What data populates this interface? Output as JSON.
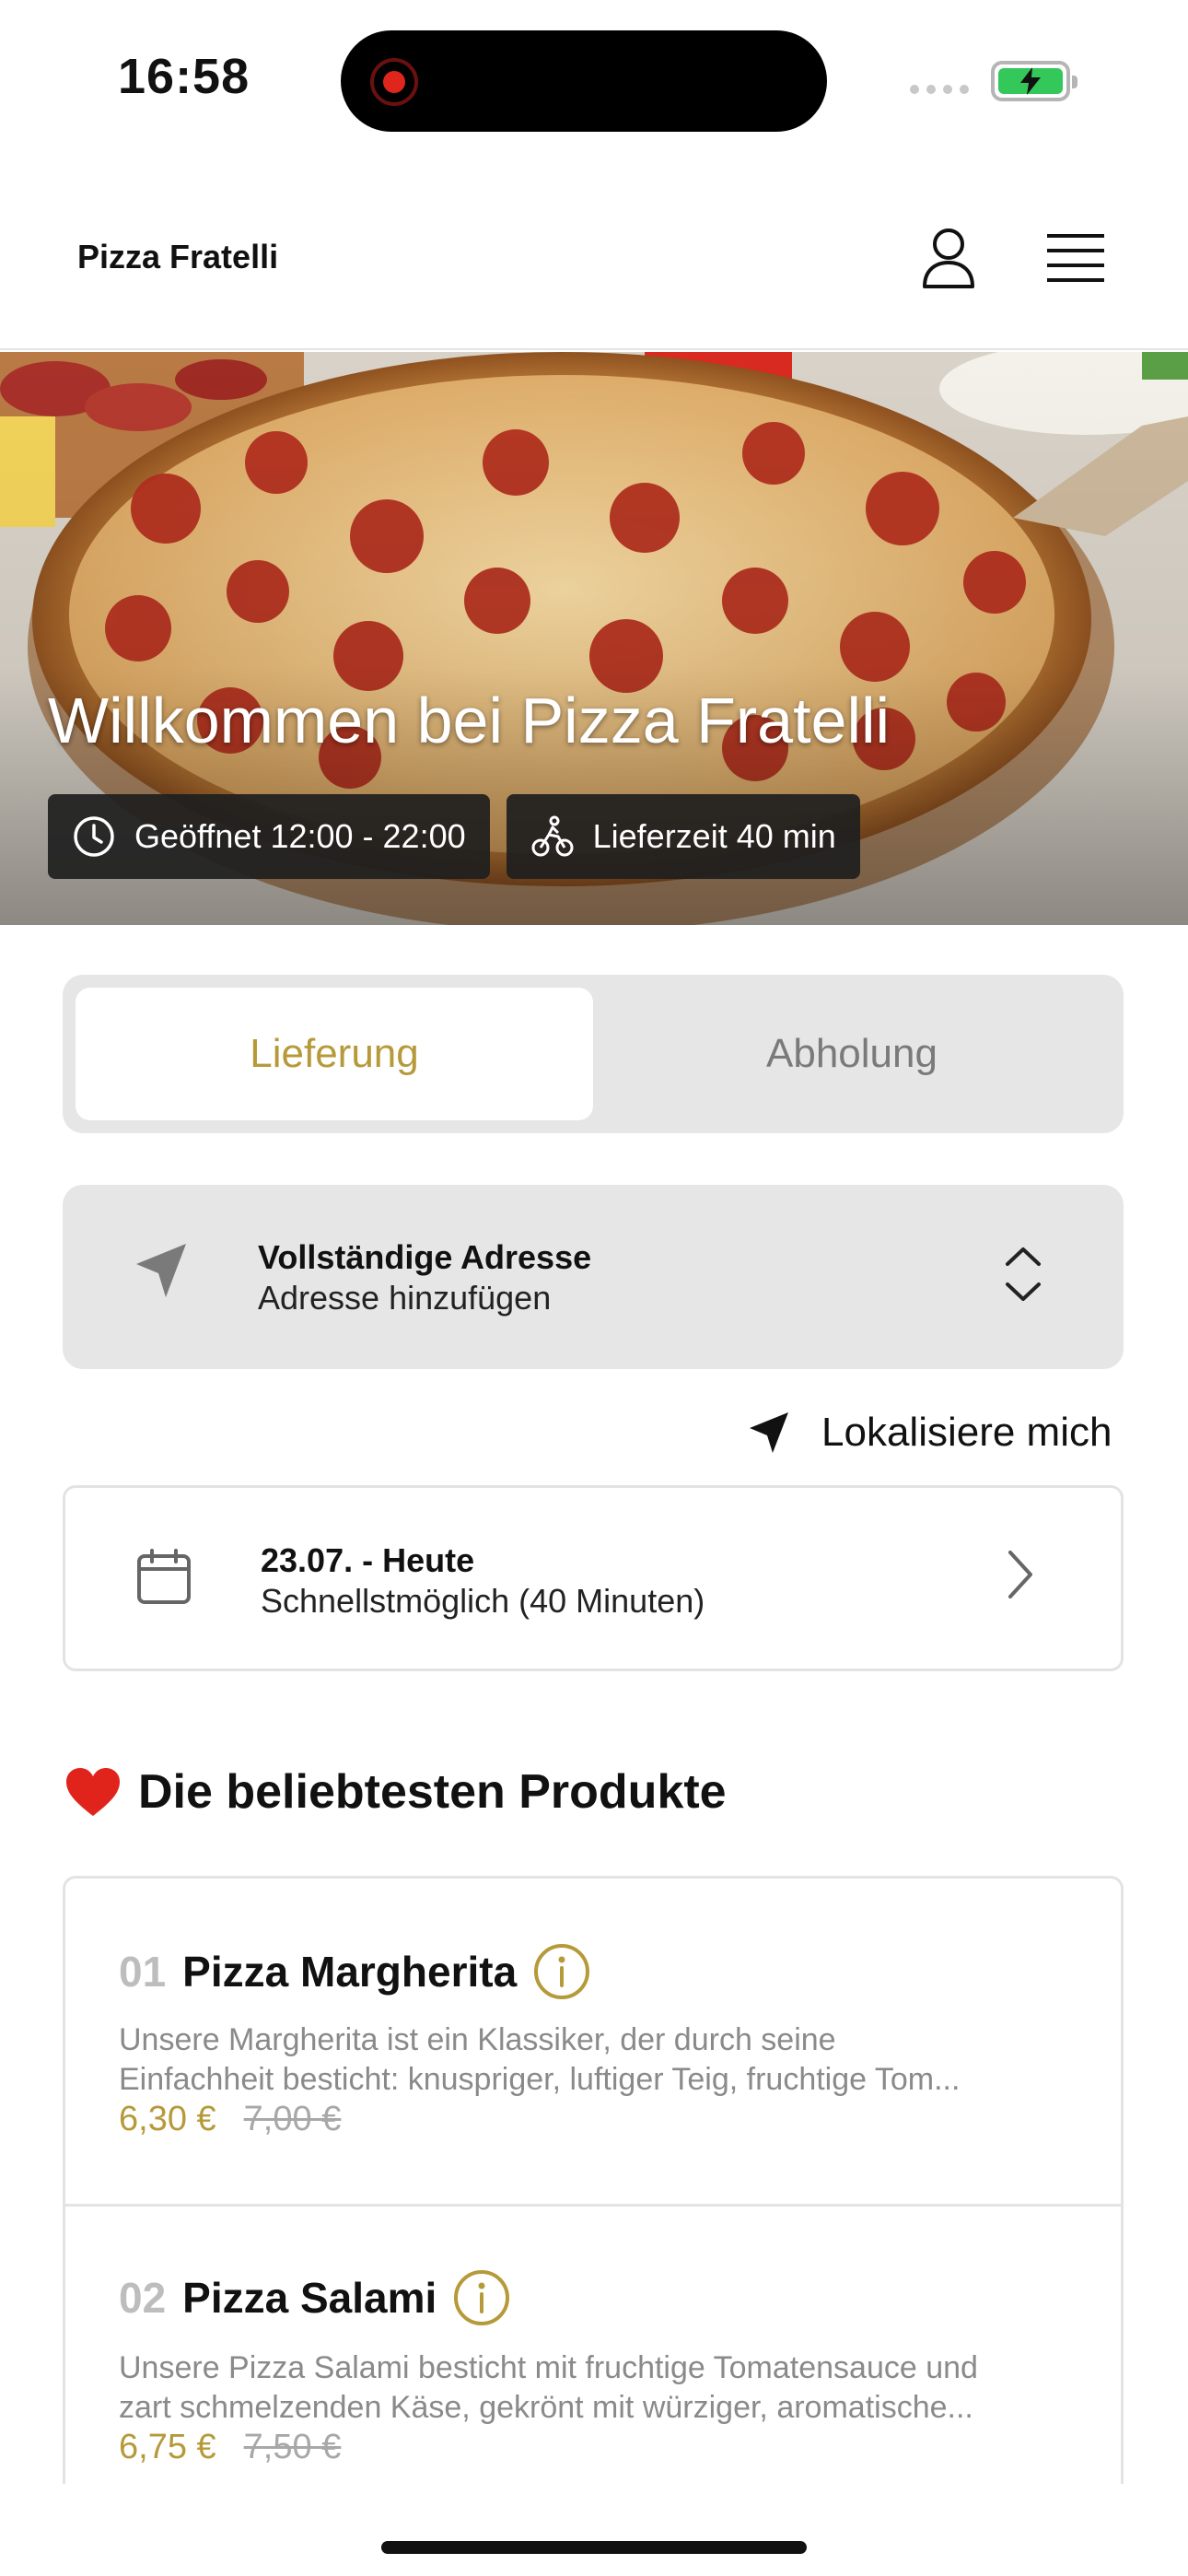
{
  "status_bar": {
    "time": "16:58",
    "battery_color": "#34c759"
  },
  "header": {
    "brand": "Pizza Fratelli",
    "profile_icon": "person-icon",
    "menu_icon": "hamburger-menu-icon"
  },
  "hero": {
    "title": "Willkommen bei Pizza Fratelli",
    "opening_hours": "Geöffnet 12:00 - 22:00",
    "delivery_time": "Lieferzeit 40 min"
  },
  "tabs": [
    {
      "label": "Lieferung",
      "active": true
    },
    {
      "label": "Abholung",
      "active": false
    }
  ],
  "address": {
    "title": "Vollständige Adresse",
    "subtitle": "Adresse hinzufügen"
  },
  "locate": {
    "label": "Lokalisiere mich"
  },
  "schedule": {
    "title": "23.07. - Heute",
    "subtitle": "Schnellstmöglich (40 Minuten)"
  },
  "popular": {
    "heading": "Die beliebtesten Produkte",
    "products": [
      {
        "number": "01",
        "name": "Pizza Margherita",
        "desc_line1": "Unsere Margherita ist ein Klassiker, der durch seine",
        "desc_line2": "Einfachheit besticht: knuspriger, luftiger Teig, fruchtige Tom...",
        "price": "6,30 €",
        "old_price": "7,00 €"
      },
      {
        "number": "02",
        "name": "Pizza Salami",
        "desc_line1": "Unsere Pizza Salami besticht mit fruchtige Tomatensauce und",
        "desc_line2": "zart schmelzenden Käse, gekrönt mit würziger, aromatische...",
        "price": "6,75 €",
        "old_price": "7,50 €"
      }
    ]
  },
  "colors": {
    "accent": "#b69a3a",
    "muted": "#8a8a8a",
    "panel": "#e6e6e6"
  }
}
